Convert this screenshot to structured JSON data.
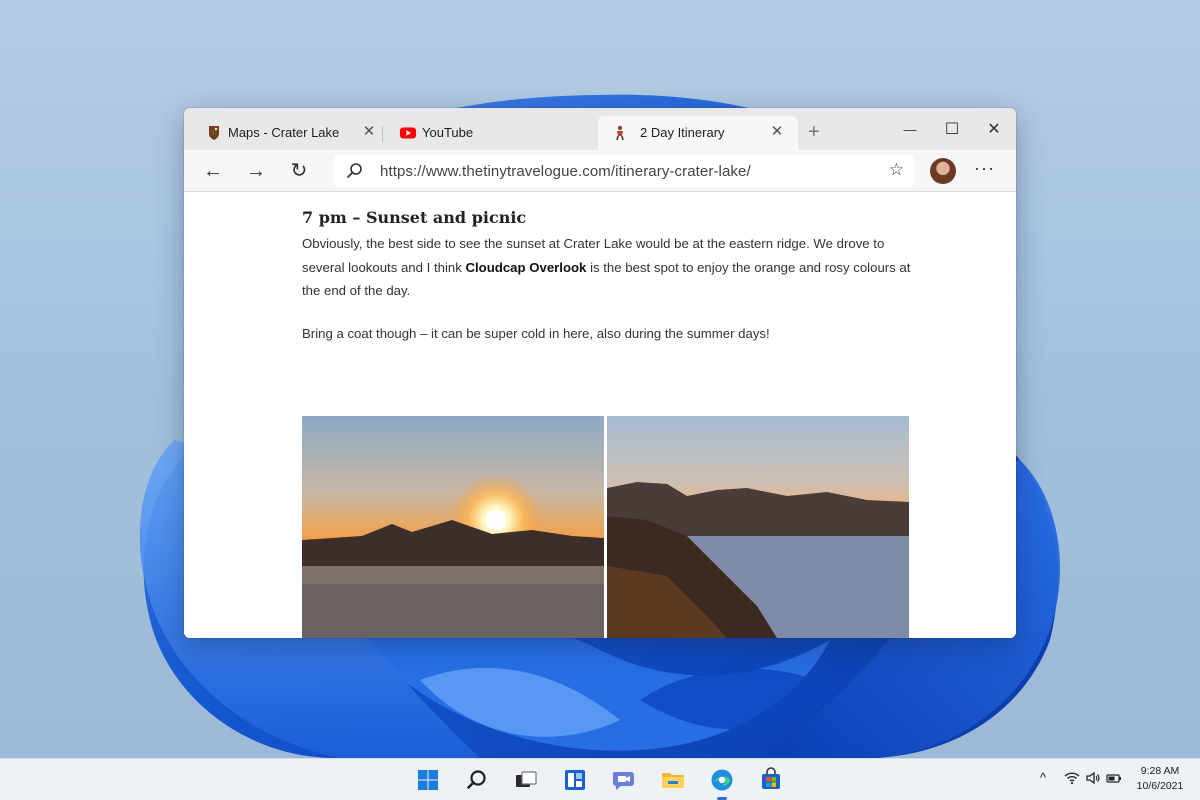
{
  "browser": {
    "tabs": [
      {
        "label": "Maps - Crater Lake",
        "icon": "park-service-icon",
        "active": false
      },
      {
        "label": "YouTube",
        "icon": "youtube-icon",
        "active": false
      },
      {
        "label": "2 Day Itinerary",
        "icon": "traveler-icon",
        "active": true
      }
    ],
    "tab_close_glyph": "✕",
    "new_tab_glyph": "+",
    "window_controls": {
      "minimize": "—",
      "maximize": "☐",
      "close": "✕"
    },
    "toolbar": {
      "back_glyph": "←",
      "forward_glyph": "→",
      "refresh_glyph": "↻",
      "url": "https://www.thetinytravelogue.com/itinerary-crater-lake/",
      "favorite_glyph": "☆",
      "more_glyph": "···"
    }
  },
  "article": {
    "heading": "7 pm – Sunset and picnic",
    "paragraph1_before": "Obviously, the best side to see the sunset at Crater Lake would be at the eastern ridge. We drove to several lookouts and I think ",
    "paragraph1_bold": "Cloudcap Overlook",
    "paragraph1_after": " is the best spot to enjoy the orange and rosy colours at the end of the day.",
    "paragraph2": "Bring a coat though – it can be super cold in here, also during the summer days!"
  },
  "taskbar": {
    "apps": [
      "start-icon",
      "search-icon",
      "task-view-icon",
      "widgets-icon",
      "chat-icon",
      "file-explorer-icon",
      "edge-icon",
      "store-icon"
    ],
    "active_app": "edge-icon",
    "tray": {
      "chevron": "^"
    },
    "clock": {
      "time": "9:28 AM",
      "date": "10/6/2021"
    }
  },
  "colors": {
    "accent": "#2f6fd6",
    "youtube_red": "#ff0000",
    "wallpaper_bloom": "#1a5fd6"
  }
}
